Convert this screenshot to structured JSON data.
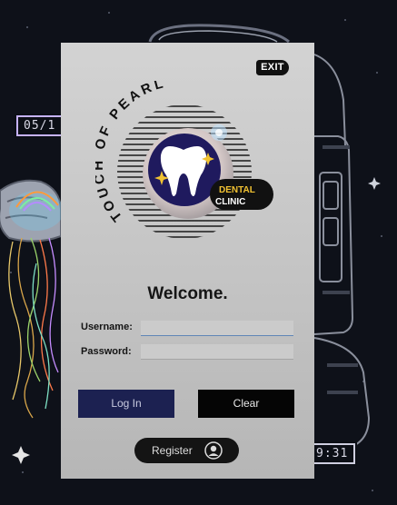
{
  "background": {
    "date_badge": "05/1",
    "time_badge": "9:31"
  },
  "panel": {
    "exit_label": "EXIT",
    "logo": {
      "arc_text": "TOUCH OF PEARL",
      "badge_line1": "DENTAL",
      "badge_line2": "CLINIC",
      "brand_colors": {
        "navy": "#1f1a5e",
        "gold": "#f1c232"
      }
    },
    "welcome": "Welcome.",
    "username_label": "Username:",
    "username_value": "",
    "password_label": "Password:",
    "password_value": "",
    "login_label": "Log In",
    "clear_label": "Clear",
    "register_label": "Register",
    "register_icon": "user-circle-icon"
  },
  "colors": {
    "panel_bg": "#c8c8c8",
    "login_btn": "#1c2151",
    "clear_btn": "#050505",
    "focus_underline": "#5f86b7"
  }
}
